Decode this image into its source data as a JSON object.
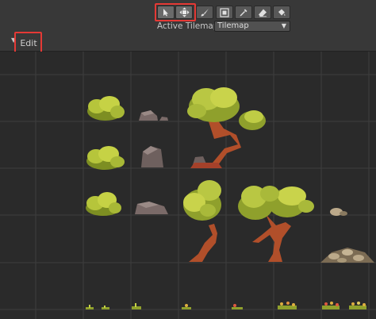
{
  "toolbar": {
    "tools": [
      {
        "name": "select-tool",
        "icon": "cursor-arrow-icon"
      },
      {
        "name": "move-tool",
        "icon": "move-arrows-icon"
      },
      {
        "name": "paint-tool",
        "icon": "brush-icon"
      },
      {
        "name": "box-fill-tool",
        "icon": "box-fill-icon"
      },
      {
        "name": "picker-tool",
        "icon": "eyedropper-icon"
      },
      {
        "name": "erase-tool",
        "icon": "eraser-icon"
      },
      {
        "name": "fill-tool",
        "icon": "paint-bucket-icon"
      }
    ],
    "active_tilemap_label": "Active Tilemap",
    "active_tilemap_value": "Tilemap",
    "highlight_color": "#e53935"
  },
  "edit": {
    "label": "Edit"
  },
  "palette": {
    "grid_color": "#3e3e3e",
    "background": "#2a2a2a",
    "tiles": [
      "bush",
      "rock",
      "large-tree",
      "small-tree",
      "grass",
      "stone-pile",
      "flowers"
    ]
  }
}
